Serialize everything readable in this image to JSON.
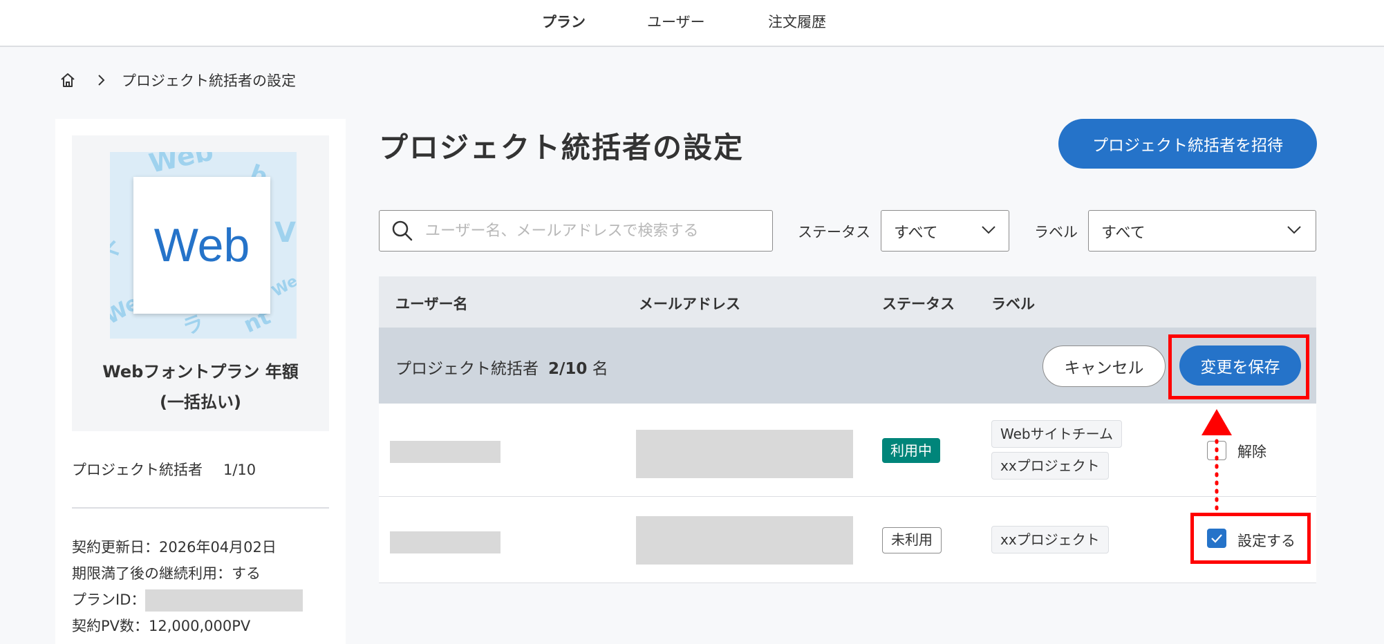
{
  "nav": {
    "items": [
      "プラン",
      "ユーザー",
      "注文履歴"
    ]
  },
  "breadcrumb": {
    "current": "プロジェクト統括者の設定"
  },
  "plan": {
    "thumb_text": "Web",
    "name_line1": "Webフォントプラン 年額",
    "name_line2": "(一括払い)",
    "count_label": "プロジェクト統括者",
    "count_value": "1/10",
    "renewal": "契約更新日：2026年04月02日",
    "continue": "期限満了後の継続利用：する",
    "plan_id_label": "プランID：",
    "pv": "契約PV数：12,000,000PV"
  },
  "page": {
    "title": "プロジェクト統括者の設定",
    "invite_label": "プロジェクト統括者を招待"
  },
  "filters": {
    "search_placeholder": "ユーザー名、メールアドレスで検索する",
    "status_label": "ステータス",
    "status_value": "すべて",
    "label_label": "ラベル",
    "label_value": "すべて"
  },
  "table": {
    "headers": [
      "ユーザー名",
      "メールアドレス",
      "ステータス",
      "ラベル"
    ],
    "edit_bar": {
      "label": "プロジェクト統括者",
      "count": "2/10",
      "unit": "名",
      "cancel": "キャンセル",
      "save": "変更を保存"
    },
    "rows": [
      {
        "status": "利用中",
        "tags": [
          "Webサイトチーム",
          "xxプロジェクト"
        ],
        "action": "解除",
        "checked": false
      },
      {
        "status": "未利用",
        "tags": [
          "xxプロジェクト"
        ],
        "action": "設定する",
        "checked": true
      }
    ]
  },
  "colors": {
    "accent": "#2573c9",
    "active_badge": "#00857a",
    "highlight": "#ff0000"
  }
}
